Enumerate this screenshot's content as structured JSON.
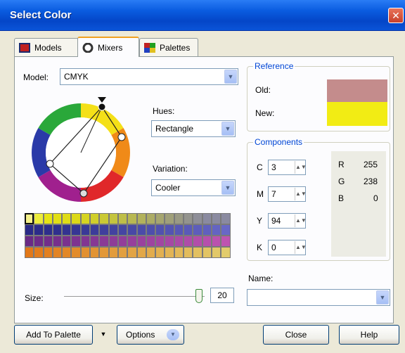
{
  "window": {
    "title": "Select Color",
    "close_glyph": "✕"
  },
  "tabs": [
    {
      "label": "Models",
      "active": false,
      "icon": "models-icon"
    },
    {
      "label": "Mixers",
      "active": true,
      "icon": "mixers-icon"
    },
    {
      "label": "Palettes",
      "active": false,
      "icon": "palettes-icon"
    }
  ],
  "model": {
    "label": "Model:",
    "value": "CMYK"
  },
  "hues": {
    "label": "Hues:",
    "value": "Rectangle"
  },
  "variation": {
    "label": "Variation:",
    "value": "Cooler"
  },
  "reference": {
    "legend": "Reference",
    "old_label": "Old:",
    "new_label": "New:",
    "old_color": "#c48c8c",
    "new_color": "#f2ec14"
  },
  "components": {
    "legend": "Components",
    "cmyk": [
      {
        "label": "C",
        "value": "3"
      },
      {
        "label": "M",
        "value": "7"
      },
      {
        "label": "Y",
        "value": "94"
      },
      {
        "label": "K",
        "value": "0"
      }
    ],
    "rgb": [
      {
        "label": "R",
        "value": "255"
      },
      {
        "label": "G",
        "value": "238"
      },
      {
        "label": "B",
        "value": "0"
      }
    ]
  },
  "swatches": {
    "rows": [
      [
        "#f4f08a",
        "#ecec3a",
        "#e6e414",
        "#e2df14",
        "#dfdc16",
        "#dcd918",
        "#d6d420",
        "#d0cf2a",
        "#cac934",
        "#c4c43e",
        "#bebe48",
        "#b8b852",
        "#b2b25c",
        "#acac66",
        "#a6a670",
        "#a0a07a",
        "#9a9a84",
        "#94948e",
        "#8e8e98",
        "#8a8aa0",
        "#8a8aa0",
        "#8a8aa0"
      ],
      [
        "#2a2a88",
        "#2c2c8a",
        "#2e2e8c",
        "#30308e",
        "#333391",
        "#363694",
        "#393997",
        "#3c3c9a",
        "#3f3f9d",
        "#4242a0",
        "#4545a3",
        "#4848a6",
        "#4b4ba9",
        "#4e4eac",
        "#5151af",
        "#5454b2",
        "#5757b5",
        "#5a5ab8",
        "#5d5dbb",
        "#6060be",
        "#6464c2",
        "#6868c6"
      ],
      [
        "#6a2a86",
        "#6e2c88",
        "#722e8a",
        "#76308c",
        "#7a328e",
        "#7e3490",
        "#823692",
        "#863894",
        "#8a3a96",
        "#8e3c98",
        "#923e9a",
        "#96409c",
        "#9a429e",
        "#9e44a0",
        "#a246a2",
        "#a648a4",
        "#aa4aa6",
        "#ae4ca8",
        "#b24eaa",
        "#b650ac",
        "#ba52ae",
        "#be54b0"
      ],
      [
        "#e27818",
        "#e27c1c",
        "#e28020",
        "#e28424",
        "#e28828",
        "#e28c2c",
        "#e29030",
        "#e29434",
        "#e29838",
        "#e29c3c",
        "#e2a040",
        "#e2a444",
        "#e2a848",
        "#e2ac4c",
        "#e2b050",
        "#e2b454",
        "#e2b858",
        "#e2bc5c",
        "#e2c060",
        "#e2c464",
        "#e2c868",
        "#e2cc6c"
      ]
    ]
  },
  "size": {
    "label": "Size:",
    "value": "20",
    "level": 0.86
  },
  "name": {
    "label": "Name:",
    "value": ""
  },
  "buttons": {
    "add_to_palette": "Add To Palette",
    "options": "Options",
    "close": "Close",
    "help": "Help"
  }
}
